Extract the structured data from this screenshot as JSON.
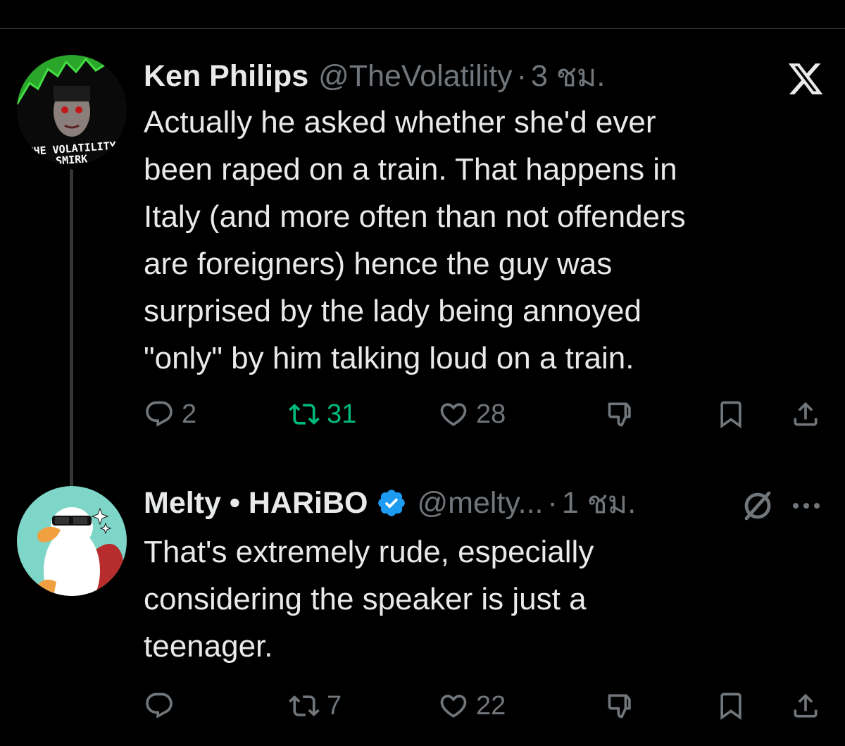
{
  "tweets": [
    {
      "name": "Ken Philips",
      "handle": "@TheVolatility",
      "separator": "·",
      "time": "3 ชม.",
      "verified": false,
      "avatar_text": [
        "THE VOLATILITY",
        "SMIRK"
      ],
      "text": "Actually he asked whether she'd ever\nbeen raped on a train. That happens in\nItaly (and more often than not offenders\nare foreigners) hence the guy was\nsurprised by the lady being annoyed\n\"only\" by him talking loud on a train.",
      "counts": {
        "reply": "2",
        "retweet": "31",
        "like": "28"
      },
      "retweeted": true,
      "corner_icon": "x-logo-icon"
    },
    {
      "name": "Melty • HARiBO",
      "handle": "@melty...",
      "separator": "·",
      "time": "1 ชม.",
      "verified": true,
      "text": "That's extremely rude, especially\nconsidering the speaker is just a\nteenager.",
      "counts": {
        "reply": "",
        "retweet": "7",
        "like": "22"
      },
      "retweeted": false,
      "corner_icons": [
        "block-icon",
        "more-icon"
      ]
    }
  ],
  "colors": {
    "background": "#000000",
    "text": "#e7e9ea",
    "muted": "#71767b",
    "retweet_green": "#00ba7c",
    "verified_blue": "#1d9bf0",
    "thread_line": "#333639"
  }
}
